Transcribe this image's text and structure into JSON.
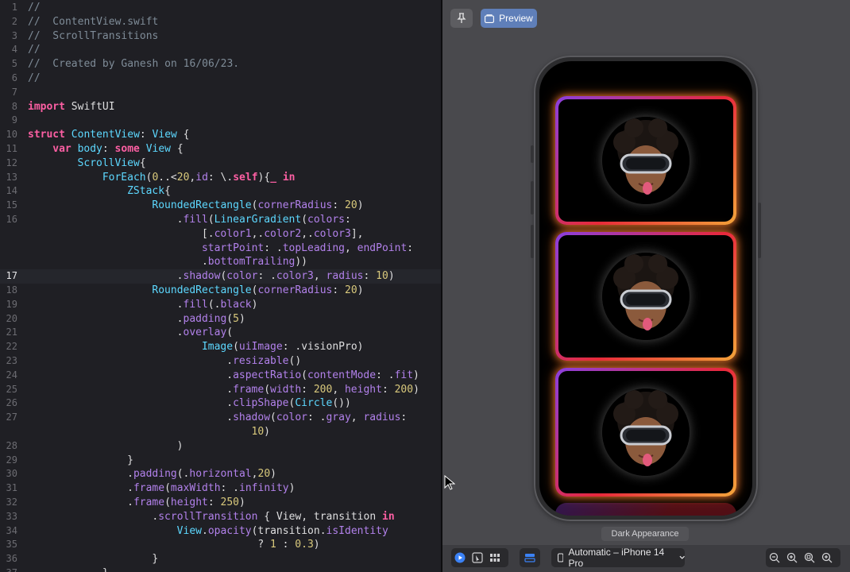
{
  "editor": {
    "current_line": 17,
    "lines": [
      {
        "n": "1",
        "indent": 0,
        "tokens": [
          [
            "comment",
            "//"
          ]
        ]
      },
      {
        "n": "2",
        "indent": 0,
        "tokens": [
          [
            "comment",
            "//  ContentView.swift"
          ]
        ]
      },
      {
        "n": "3",
        "indent": 0,
        "tokens": [
          [
            "comment",
            "//  ScrollTransitions"
          ]
        ]
      },
      {
        "n": "4",
        "indent": 0,
        "tokens": [
          [
            "comment",
            "//"
          ]
        ]
      },
      {
        "n": "5",
        "indent": 0,
        "tokens": [
          [
            "comment",
            "//  Created by Ganesh on 16/06/23."
          ]
        ]
      },
      {
        "n": "6",
        "indent": 0,
        "tokens": [
          [
            "comment",
            "//"
          ]
        ]
      },
      {
        "n": "7",
        "indent": 0,
        "tokens": []
      },
      {
        "n": "8",
        "indent": 0,
        "tokens": [
          [
            "keyword",
            "import"
          ],
          [
            "plain",
            " SwiftUI"
          ]
        ]
      },
      {
        "n": "9",
        "indent": 0,
        "tokens": []
      },
      {
        "n": "10",
        "indent": 0,
        "tokens": [
          [
            "keyword",
            "struct"
          ],
          [
            "plain",
            " "
          ],
          [
            "type",
            "ContentView"
          ],
          [
            "plain",
            ": "
          ],
          [
            "type",
            "View"
          ],
          [
            "plain",
            " {"
          ]
        ]
      },
      {
        "n": "11",
        "indent": 4,
        "tokens": [
          [
            "keyword",
            "var"
          ],
          [
            "plain",
            " "
          ],
          [
            "type",
            "body"
          ],
          [
            "plain",
            ": "
          ],
          [
            "keyword",
            "some"
          ],
          [
            "plain",
            " "
          ],
          [
            "type",
            "View"
          ],
          [
            "plain",
            " {"
          ]
        ]
      },
      {
        "n": "12",
        "indent": 8,
        "tokens": [
          [
            "type",
            "ScrollView"
          ],
          [
            "plain",
            "{"
          ]
        ]
      },
      {
        "n": "13",
        "indent": 12,
        "tokens": [
          [
            "type",
            "ForEach"
          ],
          [
            "plain",
            "("
          ],
          [
            "number",
            "0"
          ],
          [
            "plain",
            "..<"
          ],
          [
            "number",
            "20"
          ],
          [
            "plain",
            ","
          ],
          [
            "member",
            "id"
          ],
          [
            "plain",
            ": \\."
          ],
          [
            "keyword",
            "self"
          ],
          [
            "plain",
            ")"
          ],
          [
            "plain",
            "{"
          ],
          [
            "keyword",
            "_ in"
          ]
        ]
      },
      {
        "n": "14",
        "indent": 16,
        "tokens": [
          [
            "type",
            "ZStack"
          ],
          [
            "plain",
            "{"
          ]
        ]
      },
      {
        "n": "15",
        "indent": 20,
        "tokens": [
          [
            "type",
            "RoundedRectangle"
          ],
          [
            "plain",
            "("
          ],
          [
            "member",
            "cornerRadius"
          ],
          [
            "plain",
            ": "
          ],
          [
            "number",
            "20"
          ],
          [
            "plain",
            ")"
          ]
        ]
      },
      {
        "n": "16",
        "indent": 24,
        "tokens": [
          [
            "plain",
            "."
          ],
          [
            "member",
            "fill"
          ],
          [
            "plain",
            "("
          ],
          [
            "type",
            "LinearGradient"
          ],
          [
            "plain",
            "("
          ],
          [
            "member",
            "colors"
          ],
          [
            "plain",
            ":"
          ]
        ]
      },
      {
        "n": "",
        "indent": 28,
        "tokens": [
          [
            "plain",
            "[."
          ],
          [
            "member",
            "color1"
          ],
          [
            "plain",
            ",."
          ],
          [
            "member",
            "color2"
          ],
          [
            "plain",
            ",."
          ],
          [
            "member",
            "color3"
          ],
          [
            "plain",
            "],"
          ]
        ]
      },
      {
        "n": "",
        "indent": 28,
        "tokens": [
          [
            "member",
            "startPoint"
          ],
          [
            "plain",
            ": ."
          ],
          [
            "member",
            "topLeading"
          ],
          [
            "plain",
            ", "
          ],
          [
            "member",
            "endPoint"
          ],
          [
            "plain",
            ":"
          ]
        ]
      },
      {
        "n": "",
        "indent": 28,
        "tokens": [
          [
            "plain",
            "."
          ],
          [
            "member",
            "bottomTrailing"
          ],
          [
            "plain",
            "))"
          ]
        ]
      },
      {
        "n": "17",
        "indent": 24,
        "tokens": [
          [
            "plain",
            "."
          ],
          [
            "member",
            "shadow"
          ],
          [
            "plain",
            "("
          ],
          [
            "member",
            "color"
          ],
          [
            "plain",
            ": ."
          ],
          [
            "member",
            "color3"
          ],
          [
            "plain",
            ", "
          ],
          [
            "member",
            "radius"
          ],
          [
            "plain",
            ": "
          ],
          [
            "number",
            "10"
          ],
          [
            "plain",
            ")"
          ]
        ]
      },
      {
        "n": "18",
        "indent": 20,
        "tokens": [
          [
            "type",
            "RoundedRectangle"
          ],
          [
            "plain",
            "("
          ],
          [
            "member",
            "cornerRadius"
          ],
          [
            "plain",
            ": "
          ],
          [
            "number",
            "20"
          ],
          [
            "plain",
            ")"
          ]
        ]
      },
      {
        "n": "19",
        "indent": 24,
        "tokens": [
          [
            "plain",
            "."
          ],
          [
            "member",
            "fill"
          ],
          [
            "plain",
            "(."
          ],
          [
            "member",
            "black"
          ],
          [
            "plain",
            ")"
          ]
        ]
      },
      {
        "n": "20",
        "indent": 24,
        "tokens": [
          [
            "plain",
            "."
          ],
          [
            "member",
            "padding"
          ],
          [
            "plain",
            "("
          ],
          [
            "number",
            "5"
          ],
          [
            "plain",
            ")"
          ]
        ]
      },
      {
        "n": "21",
        "indent": 24,
        "tokens": [
          [
            "plain",
            "."
          ],
          [
            "member",
            "overlay"
          ],
          [
            "plain",
            "("
          ]
        ]
      },
      {
        "n": "22",
        "indent": 28,
        "tokens": [
          [
            "type",
            "Image"
          ],
          [
            "plain",
            "("
          ],
          [
            "member",
            "uiImage"
          ],
          [
            "plain",
            ": ."
          ],
          [
            "plain",
            "visionPro"
          ],
          [
            "plain",
            ")"
          ]
        ]
      },
      {
        "n": "23",
        "indent": 32,
        "tokens": [
          [
            "plain",
            "."
          ],
          [
            "member",
            "resizable"
          ],
          [
            "plain",
            "()"
          ]
        ]
      },
      {
        "n": "24",
        "indent": 32,
        "tokens": [
          [
            "plain",
            "."
          ],
          [
            "member",
            "aspectRatio"
          ],
          [
            "plain",
            "("
          ],
          [
            "member",
            "contentMode"
          ],
          [
            "plain",
            ": ."
          ],
          [
            "member",
            "fit"
          ],
          [
            "plain",
            ")"
          ]
        ]
      },
      {
        "n": "25",
        "indent": 32,
        "tokens": [
          [
            "plain",
            "."
          ],
          [
            "member",
            "frame"
          ],
          [
            "plain",
            "("
          ],
          [
            "member",
            "width"
          ],
          [
            "plain",
            ": "
          ],
          [
            "number",
            "200"
          ],
          [
            "plain",
            ", "
          ],
          [
            "member",
            "height"
          ],
          [
            "plain",
            ": "
          ],
          [
            "number",
            "200"
          ],
          [
            "plain",
            ")"
          ]
        ]
      },
      {
        "n": "26",
        "indent": 32,
        "tokens": [
          [
            "plain",
            "."
          ],
          [
            "member",
            "clipShape"
          ],
          [
            "plain",
            "("
          ],
          [
            "type",
            "Circle"
          ],
          [
            "plain",
            "())"
          ]
        ]
      },
      {
        "n": "27",
        "indent": 32,
        "tokens": [
          [
            "plain",
            "."
          ],
          [
            "member",
            "shadow"
          ],
          [
            "plain",
            "("
          ],
          [
            "member",
            "color"
          ],
          [
            "plain",
            ": ."
          ],
          [
            "member",
            "gray"
          ],
          [
            "plain",
            ", "
          ],
          [
            "member",
            "radius"
          ],
          [
            "plain",
            ":"
          ]
        ]
      },
      {
        "n": "",
        "indent": 36,
        "tokens": [
          [
            "number",
            "10"
          ],
          [
            "plain",
            ")"
          ]
        ]
      },
      {
        "n": "28",
        "indent": 24,
        "tokens": [
          [
            "plain",
            ")"
          ]
        ]
      },
      {
        "n": "29",
        "indent": 16,
        "tokens": [
          [
            "plain",
            "}"
          ]
        ]
      },
      {
        "n": "30",
        "indent": 16,
        "tokens": [
          [
            "plain",
            "."
          ],
          [
            "member",
            "padding"
          ],
          [
            "plain",
            "(."
          ],
          [
            "member",
            "horizontal"
          ],
          [
            "plain",
            ","
          ],
          [
            "number",
            "20"
          ],
          [
            "plain",
            ")"
          ]
        ]
      },
      {
        "n": "31",
        "indent": 16,
        "tokens": [
          [
            "plain",
            "."
          ],
          [
            "member",
            "frame"
          ],
          [
            "plain",
            "("
          ],
          [
            "member",
            "maxWidth"
          ],
          [
            "plain",
            ": ."
          ],
          [
            "member",
            "infinity"
          ],
          [
            "plain",
            ")"
          ]
        ]
      },
      {
        "n": "32",
        "indent": 16,
        "tokens": [
          [
            "plain",
            "."
          ],
          [
            "member",
            "frame"
          ],
          [
            "plain",
            "("
          ],
          [
            "member",
            "height"
          ],
          [
            "plain",
            ": "
          ],
          [
            "number",
            "250"
          ],
          [
            "plain",
            ")"
          ]
        ]
      },
      {
        "n": "33",
        "indent": 20,
        "tokens": [
          [
            "plain",
            "."
          ],
          [
            "member",
            "scrollTransition"
          ],
          [
            "plain",
            " { View, transition "
          ],
          [
            "keyword",
            "in"
          ]
        ]
      },
      {
        "n": "34",
        "indent": 24,
        "tokens": [
          [
            "type",
            "View"
          ],
          [
            "plain",
            "."
          ],
          [
            "member",
            "opacity"
          ],
          [
            "plain",
            "(transition."
          ],
          [
            "member",
            "isIdentity"
          ]
        ]
      },
      {
        "n": "35",
        "indent": 37,
        "tokens": [
          [
            "plain",
            "? "
          ],
          [
            "number",
            "1"
          ],
          [
            "plain",
            " : "
          ],
          [
            "number",
            "0.3"
          ],
          [
            "plain",
            ")"
          ]
        ]
      },
      {
        "n": "36",
        "indent": 20,
        "tokens": [
          [
            "plain",
            "}"
          ]
        ]
      },
      {
        "n": "37",
        "indent": 12,
        "tokens": [
          [
            "plain",
            "}"
          ]
        ]
      }
    ]
  },
  "preview_toolbar": {
    "pin_icon": "pin-icon",
    "preview_label": "Preview",
    "preview_icon": "preview-icon"
  },
  "canvas": {
    "appearance_label": "Dark Appearance",
    "device_label": "Automatic – iPhone 14 Pro",
    "card_colors": {
      "color1": "#8a3fe0",
      "color2": "#e8283c",
      "color3": "#f3a53a"
    }
  },
  "bottom_bar": {
    "left_icons": [
      "live-preview-icon",
      "selectable-icon",
      "variants-icon"
    ],
    "mode_icon": "device-settings-icon",
    "zoom_icons": [
      "zoom-out-icon",
      "zoom-in-icon",
      "zoom-fit-icon",
      "zoom-actual-icon"
    ]
  },
  "accent": "#5f7fb9"
}
